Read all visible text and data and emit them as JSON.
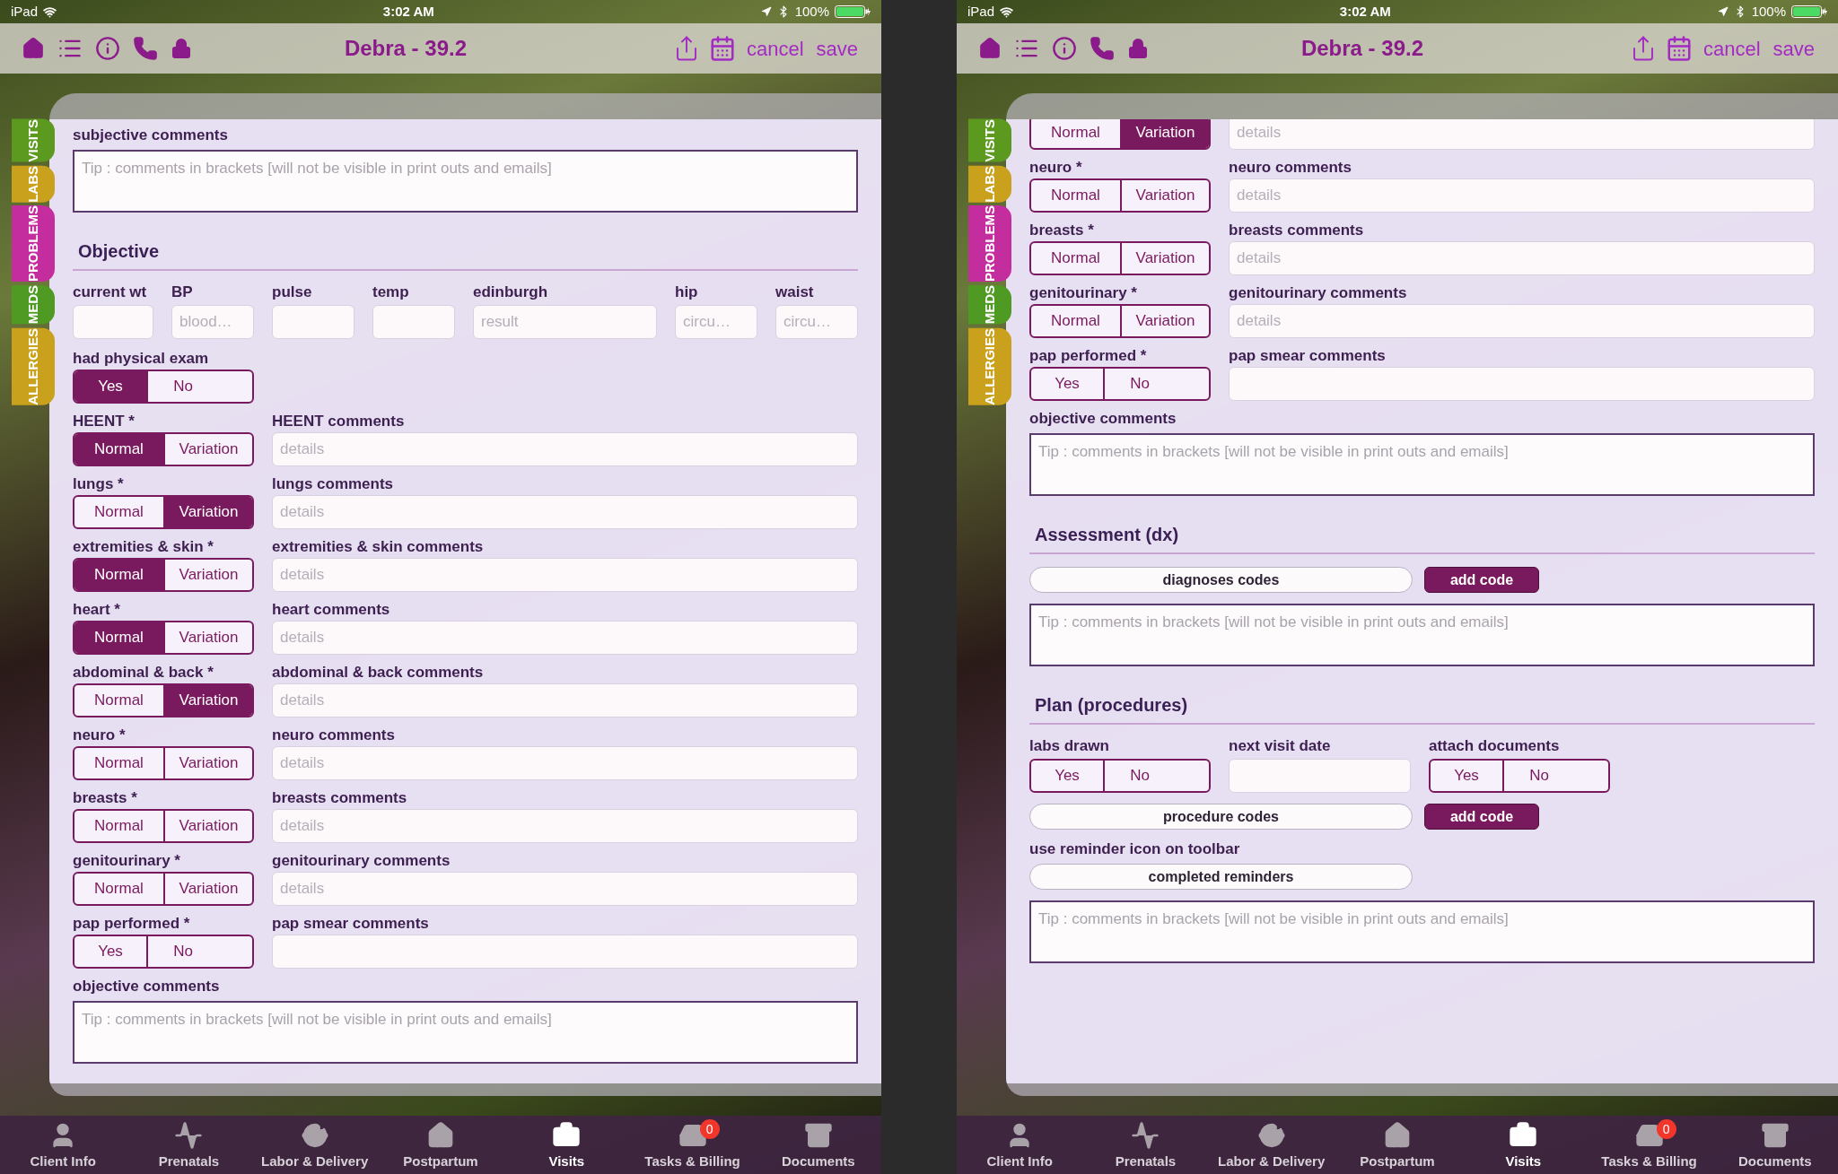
{
  "screens": [
    {
      "status_bar": {
        "carrier": "iPad",
        "time": "3:02 AM",
        "battery": "100%"
      },
      "nav": {
        "title": "Debra - 39.2",
        "actions": [
          "cancel",
          "save"
        ]
      },
      "side_tabs": [
        {
          "label": "VISITS",
          "color": "#5b9a1f"
        },
        {
          "label": "LABS",
          "color": "#c9a11c"
        },
        {
          "label": "PROBLEMS",
          "color": "#c42d9e"
        },
        {
          "label": "MEDS",
          "color": "#4f9a22"
        },
        {
          "label": "ALLERGIES",
          "color": "#c9a11c"
        }
      ],
      "blocks": [
        {
          "kind": "label",
          "text": "subjective comments"
        },
        {
          "kind": "textarea",
          "placeholder": "Tip : comments in brackets [will not be visible in print outs and emails]"
        },
        {
          "kind": "heading",
          "text": "Objective"
        },
        {
          "kind": "vitals",
          "fields": [
            {
              "label": "current wt"
            },
            {
              "label": "BP",
              "placeholder": "blood…"
            },
            {
              "label": "pulse"
            },
            {
              "label": "temp"
            },
            {
              "label": "edinburgh",
              "placeholder": "result"
            },
            {
              "label": "hip",
              "placeholder": "circu…"
            },
            {
              "label": "waist",
              "placeholder": "circu…"
            }
          ]
        },
        {
          "kind": "toggle",
          "label": "had physical exam",
          "options": [
            {
              "label": "Yes",
              "selected": true
            },
            {
              "label": "No",
              "selected": false
            }
          ]
        },
        {
          "kind": "toggle",
          "label": "HEENT *",
          "options": [
            {
              "label": "Normal",
              "selected": true
            },
            {
              "label": "Variation",
              "selected": false
            }
          ],
          "comment": {
            "label": "HEENT comments",
            "placeholder": "details"
          }
        },
        {
          "kind": "toggle",
          "label": "lungs *",
          "options": [
            {
              "label": "Normal",
              "selected": false
            },
            {
              "label": "Variation",
              "selected": true
            }
          ],
          "comment": {
            "label": "lungs comments",
            "placeholder": "details"
          }
        },
        {
          "kind": "toggle",
          "label": "extremities & skin *",
          "options": [
            {
              "label": "Normal",
              "selected": true
            },
            {
              "label": "Variation",
              "selected": false
            }
          ],
          "comment": {
            "label": "extremities & skin comments",
            "placeholder": "details"
          }
        },
        {
          "kind": "toggle",
          "label": "heart *",
          "options": [
            {
              "label": "Normal",
              "selected": true
            },
            {
              "label": "Variation",
              "selected": false
            }
          ],
          "comment": {
            "label": "heart comments",
            "placeholder": "details"
          }
        },
        {
          "kind": "toggle",
          "label": "abdominal & back *",
          "options": [
            {
              "label": "Normal",
              "selected": false
            },
            {
              "label": "Variation",
              "selected": true
            }
          ],
          "comment": {
            "label": "abdominal & back comments",
            "placeholder": "details"
          }
        },
        {
          "kind": "toggle",
          "label": "neuro *",
          "options": [
            {
              "label": "Normal",
              "selected": false
            },
            {
              "label": "Variation",
              "selected": false
            }
          ],
          "comment": {
            "label": "neuro comments",
            "placeholder": "details"
          }
        },
        {
          "kind": "toggle",
          "label": "breasts *",
          "options": [
            {
              "label": "Normal",
              "selected": false
            },
            {
              "label": "Variation",
              "selected": false
            }
          ],
          "comment": {
            "label": "breasts comments",
            "placeholder": "details"
          }
        },
        {
          "kind": "toggle",
          "label": "genitourinary *",
          "options": [
            {
              "label": "Normal",
              "selected": false
            },
            {
              "label": "Variation",
              "selected": false
            }
          ],
          "comment": {
            "label": "genitourinary comments",
            "placeholder": "details"
          }
        },
        {
          "kind": "toggle",
          "label": "pap performed *",
          "options": [
            {
              "label": "Yes",
              "selected": false
            },
            {
              "label": "No",
              "selected": false
            }
          ],
          "comment": {
            "label": "pap smear comments"
          }
        },
        {
          "kind": "label",
          "text": "objective comments"
        },
        {
          "kind": "textarea",
          "placeholder": "Tip : comments in brackets [will not be visible in print outs and emails]"
        }
      ],
      "tab_bar": [
        {
          "label": "Client Info",
          "selected": false
        },
        {
          "label": "Prenatals",
          "selected": false
        },
        {
          "label": "Labor & Delivery",
          "selected": false
        },
        {
          "label": "Postpartum",
          "selected": false
        },
        {
          "label": "Visits",
          "selected": true
        },
        {
          "label": "Tasks & Billing",
          "selected": false,
          "badge": "0"
        },
        {
          "label": "Documents",
          "selected": false
        }
      ]
    },
    {
      "status_bar": {
        "carrier": "iPad",
        "time": "3:02 AM",
        "battery": "100%"
      },
      "nav": {
        "title": "Debra - 39.2",
        "actions": [
          "cancel",
          "save"
        ]
      },
      "side_tabs": [
        {
          "label": "VISITS",
          "color": "#5b9a1f"
        },
        {
          "label": "LABS",
          "color": "#c9a11c"
        },
        {
          "label": "PROBLEMS",
          "color": "#c42d9e"
        },
        {
          "label": "MEDS",
          "color": "#4f9a22"
        },
        {
          "label": "ALLERGIES",
          "color": "#c9a11c"
        }
      ],
      "blocks": [
        {
          "kind": "toggle",
          "scrolled_partly": true,
          "options": [
            {
              "label": "Normal",
              "selected": false
            },
            {
              "label": "Variation",
              "selected": true
            }
          ],
          "comment": {
            "placeholder": "details"
          }
        },
        {
          "kind": "toggle",
          "label": "neuro *",
          "options": [
            {
              "label": "Normal",
              "selected": false
            },
            {
              "label": "Variation",
              "selected": false
            }
          ],
          "comment": {
            "label": "neuro comments",
            "placeholder": "details"
          }
        },
        {
          "kind": "toggle",
          "label": "breasts *",
          "options": [
            {
              "label": "Normal",
              "selected": false
            },
            {
              "label": "Variation",
              "selected": false
            }
          ],
          "comment": {
            "label": "breasts comments",
            "placeholder": "details"
          }
        },
        {
          "kind": "toggle",
          "label": "genitourinary *",
          "options": [
            {
              "label": "Normal",
              "selected": false
            },
            {
              "label": "Variation",
              "selected": false
            }
          ],
          "comment": {
            "label": "genitourinary comments",
            "placeholder": "details"
          }
        },
        {
          "kind": "toggle",
          "label": "pap performed *",
          "options": [
            {
              "label": "Yes",
              "selected": false
            },
            {
              "label": "No",
              "selected": false
            }
          ],
          "comment": {
            "label": "pap smear comments"
          }
        },
        {
          "kind": "label",
          "text": "objective comments"
        },
        {
          "kind": "textarea",
          "placeholder": "Tip : comments in brackets [will not be visible in print outs and emails]"
        },
        {
          "kind": "heading",
          "text": "Assessment (dx)"
        },
        {
          "kind": "code_row",
          "field": "diagnoses codes",
          "button": "add code"
        },
        {
          "kind": "textarea",
          "placeholder": "Tip : comments in brackets [will not be visible in print outs and emails]"
        },
        {
          "kind": "heading",
          "text": "Plan (procedures)"
        },
        {
          "kind": "plan_row",
          "items": [
            {
              "kind": "toggle",
              "label": "labs drawn",
              "options": [
                {
                  "label": "Yes",
                  "selected": false
                },
                {
                  "label": "No",
                  "selected": false
                }
              ]
            },
            {
              "kind": "field",
              "label": "next visit date"
            },
            {
              "kind": "toggle",
              "label": "attach documents",
              "options": [
                {
                  "label": "Yes",
                  "selected": false
                },
                {
                  "label": "No",
                  "selected": false
                }
              ]
            }
          ]
        },
        {
          "kind": "code_row",
          "field": "procedure codes",
          "button": "add code"
        },
        {
          "kind": "label",
          "text": "use reminder icon on toolbar"
        },
        {
          "kind": "pill",
          "text": "completed reminders"
        },
        {
          "kind": "textarea",
          "placeholder": "Tip : comments in brackets [will not be visible in print outs and emails]"
        }
      ],
      "tab_bar": [
        {
          "label": "Client Info",
          "selected": false
        },
        {
          "label": "Prenatals",
          "selected": false
        },
        {
          "label": "Labor & Delivery",
          "selected": false
        },
        {
          "label": "Postpartum",
          "selected": false
        },
        {
          "label": "Visits",
          "selected": true
        },
        {
          "label": "Tasks & Billing",
          "selected": false,
          "badge": "0"
        },
        {
          "label": "Documents",
          "selected": false
        }
      ]
    }
  ]
}
